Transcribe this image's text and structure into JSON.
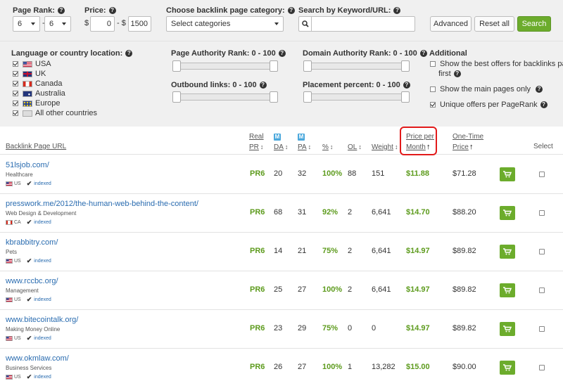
{
  "filters": {
    "page_rank": {
      "label": "Page Rank:",
      "from": "6",
      "to": "6",
      "dash": "-"
    },
    "price": {
      "label": "Price:",
      "currency": "$",
      "from": "0",
      "to": "1500",
      "dash": "- $"
    },
    "category": {
      "label": "Choose backlink page category:",
      "value": "Select categories"
    },
    "search": {
      "label": "Search by Keyword/URL:",
      "value": ""
    },
    "buttons": {
      "advanced": "Advanced",
      "reset": "Reset all",
      "search": "Search"
    }
  },
  "panel": {
    "language": {
      "label": "Language or country location:",
      "items": [
        {
          "label": "USA",
          "checked": true,
          "flag": "us"
        },
        {
          "label": "UK",
          "checked": true,
          "flag": "uk"
        },
        {
          "label": "Canada",
          "checked": true,
          "flag": "ca"
        },
        {
          "label": "Australia",
          "checked": true,
          "flag": "au"
        },
        {
          "label": "Europe",
          "checked": true,
          "flag": "eu"
        },
        {
          "label": "All other countries",
          "checked": true,
          "flag": "all"
        }
      ]
    },
    "page_authority": {
      "label": "Page Authority Rank: 0 - 100"
    },
    "domain_authority": {
      "label": "Domain Authority Rank: 0 - 100"
    },
    "outbound_links": {
      "label": "Outbound links: 0 - 100"
    },
    "placement_percent": {
      "label": "Placement percent: 0 - 100"
    },
    "additional": {
      "label": "Additional",
      "best_offers_line1": "Show the best offers for backlinks pages",
      "best_offers_line2": "first",
      "main_pages": "Show the main pages only",
      "unique_offers": "Unique offers per PageRank"
    }
  },
  "table": {
    "headers": {
      "url": "Backlink Page URL",
      "real": "Real",
      "pr": "PR",
      "da": "DA",
      "pa": "PA",
      "pct": "%",
      "ol": "OL",
      "weight": "Weight",
      "ppm_line1": "Price per",
      "ppm_line2": "Month",
      "onetime_line1": "One-Time",
      "onetime_line2": "Price",
      "select": "Select",
      "m": "M"
    },
    "rows": [
      {
        "url": "51lsjob.com/",
        "category": "Healthcare",
        "country": "US",
        "indexed": "indexed",
        "pr": "PR6",
        "da": "20",
        "pa": "32",
        "pct": "100%",
        "ol": "88",
        "weight": "151",
        "ppm": "$11.88",
        "onetime": "$71.28"
      },
      {
        "url": "presswork.me/2012/the-human-web-behind-the-content/",
        "category": "Web Design & Development",
        "country": "CA",
        "indexed": "indexed",
        "pr": "PR6",
        "da": "68",
        "pa": "31",
        "pct": "92%",
        "ol": "2",
        "weight": "6,641",
        "ppm": "$14.70",
        "onetime": "$88.20"
      },
      {
        "url": "kbrabbitry.com/",
        "category": "Pets",
        "country": "US",
        "indexed": "indexed",
        "pr": "PR6",
        "da": "14",
        "pa": "21",
        "pct": "75%",
        "ol": "2",
        "weight": "6,641",
        "ppm": "$14.97",
        "onetime": "$89.82"
      },
      {
        "url": "www.rccbc.org/",
        "category": "Management",
        "country": "US",
        "indexed": "indexed",
        "pr": "PR6",
        "da": "25",
        "pa": "27",
        "pct": "100%",
        "ol": "2",
        "weight": "6,641",
        "ppm": "$14.97",
        "onetime": "$89.82"
      },
      {
        "url": "www.bitecointalk.org/",
        "category": "Making Money Online",
        "country": "US",
        "indexed": "indexed",
        "pr": "PR6",
        "da": "23",
        "pa": "29",
        "pct": "75%",
        "ol": "0",
        "weight": "0",
        "ppm": "$14.97",
        "onetime": "$89.82"
      },
      {
        "url": "www.okmlaw.com/",
        "category": "Business Services",
        "country": "US",
        "indexed": "indexed",
        "pr": "PR6",
        "da": "26",
        "pa": "27",
        "pct": "100%",
        "ol": "1",
        "weight": "13,282",
        "ppm": "$15.00",
        "onetime": "$90.00"
      }
    ]
  },
  "colors": {
    "accent_green": "#6cac2c",
    "link_blue": "#2a6cb0",
    "highlight_red": "#e21a1a"
  }
}
